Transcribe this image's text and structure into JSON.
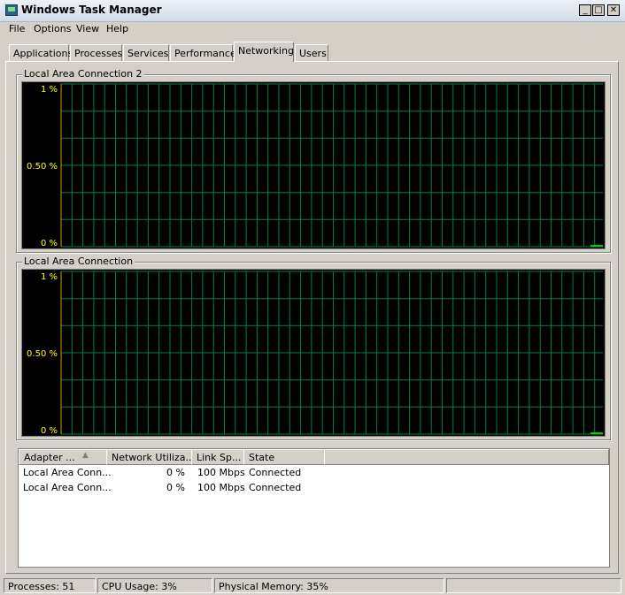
{
  "window": {
    "title": "Windows Task Manager",
    "controls": {
      "minimize": "_",
      "maximize": "□",
      "close": "✕"
    }
  },
  "menu": [
    "File",
    "Options",
    "View",
    "Help"
  ],
  "tabs": [
    "Applications",
    "Processes",
    "Services",
    "Performance",
    "Networking",
    "Users"
  ],
  "active_tab": "Networking",
  "graphs": [
    {
      "title": "Local Area Connection 2",
      "y_labels": [
        "1 %",
        "0.50 %",
        "0 %"
      ],
      "utilization_percent": 0
    },
    {
      "title": "Local Area Connection",
      "y_labels": [
        "1 %",
        "0.50 %",
        "0 %"
      ],
      "utilization_percent": 0
    }
  ],
  "adapter_table": {
    "columns": [
      "Adapter ...",
      "Network Utiliza...",
      "Link Sp...",
      "State"
    ],
    "rows": [
      [
        "Local Area Conn...",
        "0 %",
        "100 Mbps",
        "Connected"
      ],
      [
        "Local Area Conn...",
        "0 %",
        "100 Mbps",
        "Connected"
      ]
    ]
  },
  "status": {
    "processes": "Processes: 51",
    "cpu": "CPU Usage: 3%",
    "memory": "Physical Memory: 35%"
  },
  "colors": {
    "graph_bg": "#000000",
    "grid": "#008040",
    "trace": "#00ff00",
    "label": "#ffff00",
    "axis": "#c8a000"
  }
}
